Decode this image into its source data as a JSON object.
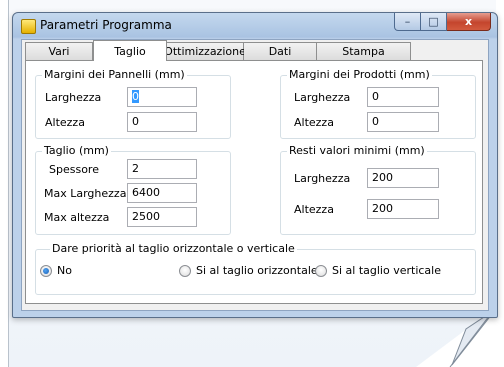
{
  "window": {
    "title": "Parametri Programma",
    "controls": {
      "minimize": "–",
      "maximize": "□",
      "close": "x"
    }
  },
  "tabs": [
    {
      "label": "Vari"
    },
    {
      "label": "Taglio",
      "active": true
    },
    {
      "label": "Ottimizzazione"
    },
    {
      "label": "Dati"
    },
    {
      "label": "Stampa"
    }
  ],
  "margini_pannelli": {
    "title": "Margini dei Pannelli  (mm)",
    "larghezza_label": "Larghezza",
    "larghezza_value": "0",
    "altezza_label": "Altezza",
    "altezza_value": "0"
  },
  "margini_prodotti": {
    "title": "Margini dei Prodotti  (mm)",
    "larghezza_label": "Larghezza",
    "larghezza_value": "0",
    "altezza_label": "Altezza",
    "altezza_value": "0"
  },
  "taglio": {
    "title": "Taglio  (mm)",
    "spessore_label": "Spessore",
    "spessore_value": "2",
    "max_larghezza_label": "Max Larghezza",
    "max_larghezza_value": "6400",
    "max_altezza_label": "Max altezza",
    "max_altezza_value": "2500"
  },
  "resti": {
    "title": "Resti valori minimi  (mm)",
    "larghezza_label": "Larghezza",
    "larghezza_value": "200",
    "altezza_label": "Altezza",
    "altezza_value": "200"
  },
  "priorita": {
    "title": "Dare priorità al taglio orizzontale o verticale",
    "options": [
      {
        "label": "No",
        "selected": true
      },
      {
        "label": "Si al taglio orizzontale",
        "selected": false
      },
      {
        "label": "Si al taglio verticale",
        "selected": false
      }
    ]
  }
}
